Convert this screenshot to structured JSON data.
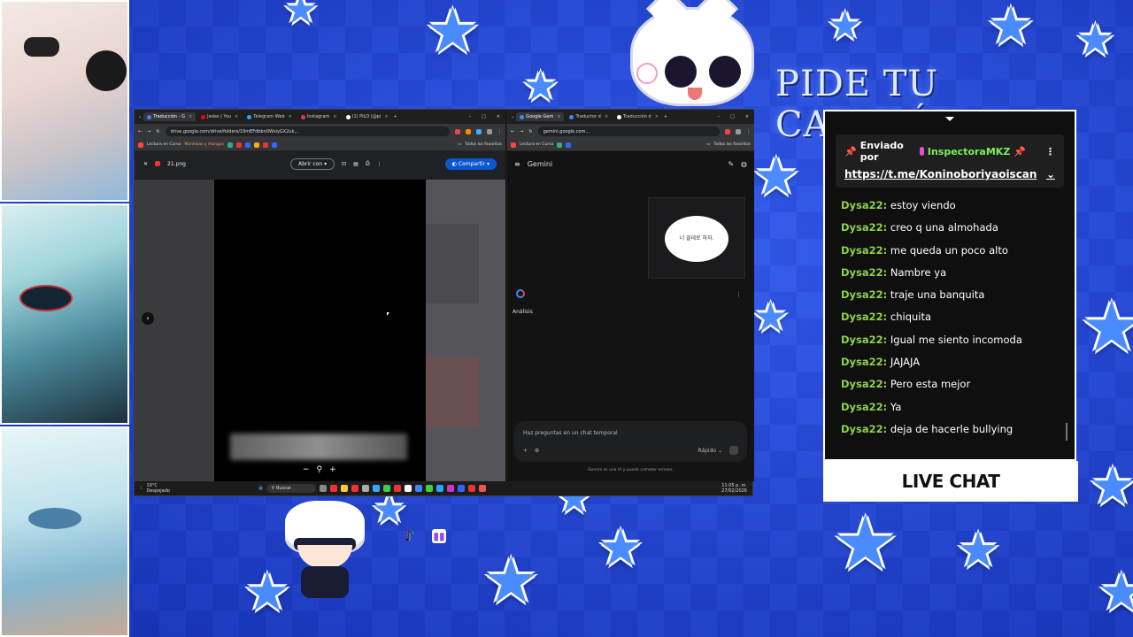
{
  "overlay": {
    "title": "PIDE TU CANCIÓN",
    "live_chat_label": "LIVE CHAT"
  },
  "left_browser": {
    "tabs": [
      {
        "label": "Traducción - G",
        "color": "#4285f4",
        "active": true
      },
      {
        "label": "Jadas | You",
        "color": "#ff0000"
      },
      {
        "label": "Telegram Web",
        "color": "#2aabee"
      },
      {
        "label": "Instagram",
        "color": "#e1306c"
      },
      {
        "label": "(1) PILO (@pi",
        "color": "#ffffff"
      }
    ],
    "url": "drive.google.com/drive/folders/19mEFdbbn0WsiyGX2uk...",
    "bookmarks": [
      "Lectura en Curso",
      "Manhwas y mangas"
    ],
    "bookmarks_right": "Todos los favoritos",
    "file_name": "21.png",
    "open_with": "Abrir con",
    "share": "Compartir"
  },
  "right_browser": {
    "tabs": [
      {
        "label": "Google Gem",
        "color": "#4285f4",
        "active": true
      },
      {
        "label": "Traductor d",
        "color": "#4285f4"
      },
      {
        "label": "Traducción d",
        "color": "#ffffff"
      }
    ],
    "url": "gemini.google.com...",
    "bookmarks": [
      "Lectura en Curso"
    ],
    "bookmarks_right": "Todos los favoritos",
    "app_name": "Gemini",
    "image_text": "너 꼴데로 하자.",
    "analysis_label": "Análisis",
    "input_placeholder": "Haz preguntas en un chat temporal",
    "mode": "Rápido",
    "disclaimer": "Gemini es una IA y puede cometer errores."
  },
  "taskbar": {
    "temp": "19°C",
    "weather": "Despejado",
    "search": "Buscar",
    "time": "11:05 p. m.",
    "date": "27/02/2026"
  },
  "chat": {
    "pinned_prefix": "Enviado por",
    "pinned_user": "InspectoraMKZ",
    "pinned_link": "https://t.me/Koninoboriyaoiscan",
    "messages": [
      {
        "user": "Dysa22:",
        "text": "estoy viendo"
      },
      {
        "user": "Dysa22:",
        "text": "creo q una almohada"
      },
      {
        "user": "Dysa22:",
        "text": "me queda un poco alto"
      },
      {
        "user": "Dysa22:",
        "text": "Nambre ya"
      },
      {
        "user": "Dysa22:",
        "text": "traje una banquita"
      },
      {
        "user": "Dysa22:",
        "text": "chiquita"
      },
      {
        "user": "Dysa22:",
        "text": "Igual me siento incomoda"
      },
      {
        "user": "Dysa22:",
        "text": "JAJAJA"
      },
      {
        "user": "Dysa22:",
        "text": "Pero esta mejor"
      },
      {
        "user": "Dysa22:",
        "text": "Ya"
      },
      {
        "user": "Dysa22:",
        "text": "deja de hacerle bullying"
      }
    ]
  },
  "icons": {
    "tiktok": "tiktok-icon",
    "twitch": "twitch-icon"
  },
  "colors": {
    "background": "#1f45d9",
    "chat_username": "#8fd14a",
    "pinned_username": "#7bf05a",
    "share_button": "#0b57d0"
  }
}
